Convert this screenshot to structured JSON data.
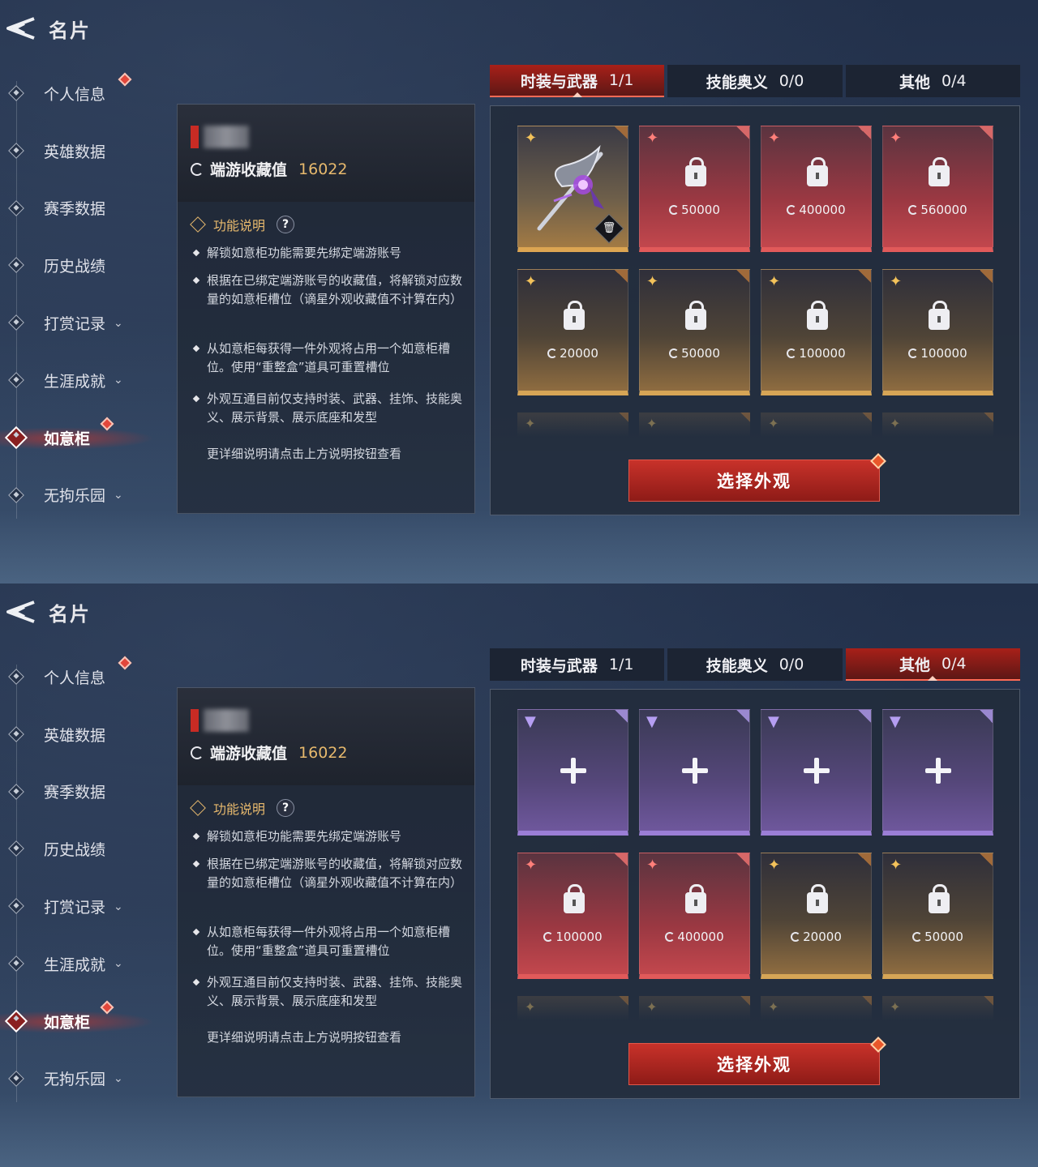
{
  "screens": [
    {
      "page_title": "名片",
      "nav": [
        {
          "label": "个人信息",
          "dot": true,
          "chevron": false
        },
        {
          "label": "英雄数据",
          "dot": false,
          "chevron": false
        },
        {
          "label": "赛季数据",
          "dot": false,
          "chevron": false
        },
        {
          "label": "历史战绩",
          "dot": false,
          "chevron": false
        },
        {
          "label": "打赏记录",
          "dot": false,
          "chevron": true
        },
        {
          "label": "生涯成就",
          "dot": false,
          "chevron": true
        },
        {
          "label": "如意柜",
          "dot": true,
          "chevron": false,
          "active": true
        },
        {
          "label": "无拘乐园",
          "dot": false,
          "chevron": true
        }
      ],
      "info": {
        "collection_label": "端游收藏值",
        "collection_value": "16022",
        "func_title": "功能说明",
        "help": "?",
        "bullets": [
          "解锁如意柜功能需要先绑定端游账号",
          "根据在已绑定端游账号的收藏值，将解锁对应数量的如意柜槽位（谪星外观收藏值不计算在内）",
          "从如意柜每获得一件外观将占用一个如意柜槽位。使用“重整盒”道具可重置槽位",
          "外观互通目前仅支持时装、武器、挂饰、技能奥义、展示背景、展示底座和发型"
        ],
        "more": "更详细说明请点击上方说明按钮查看"
      },
      "tabs": [
        {
          "label": "时装与武器",
          "count": "1/1",
          "active": true
        },
        {
          "label": "技能奥义",
          "count": "0/0",
          "active": false
        },
        {
          "label": "其他",
          "count": "0/4",
          "active": false
        }
      ],
      "slots": [
        {
          "type": "weapon",
          "color": "wep"
        },
        {
          "type": "locked",
          "color": "red",
          "cost": "50000"
        },
        {
          "type": "locked",
          "color": "red",
          "cost": "400000"
        },
        {
          "type": "locked",
          "color": "red",
          "cost": "560000"
        },
        {
          "type": "locked",
          "color": "gold",
          "cost": "20000"
        },
        {
          "type": "locked",
          "color": "gold",
          "cost": "50000"
        },
        {
          "type": "locked",
          "color": "gold",
          "cost": "100000"
        },
        {
          "type": "locked",
          "color": "gold",
          "cost": "100000"
        }
      ],
      "select_button": "选择外观"
    },
    {
      "page_title": "名片",
      "nav": [
        {
          "label": "个人信息",
          "dot": true,
          "chevron": false
        },
        {
          "label": "英雄数据",
          "dot": false,
          "chevron": false
        },
        {
          "label": "赛季数据",
          "dot": false,
          "chevron": false
        },
        {
          "label": "历史战绩",
          "dot": false,
          "chevron": false
        },
        {
          "label": "打赏记录",
          "dot": false,
          "chevron": true
        },
        {
          "label": "生涯成就",
          "dot": false,
          "chevron": true
        },
        {
          "label": "如意柜",
          "dot": true,
          "chevron": false,
          "active": true
        },
        {
          "label": "无拘乐园",
          "dot": false,
          "chevron": true
        }
      ],
      "info": {
        "collection_label": "端游收藏值",
        "collection_value": "16022",
        "func_title": "功能说明",
        "help": "?",
        "bullets": [
          "解锁如意柜功能需要先绑定端游账号",
          "根据在已绑定端游账号的收藏值，将解锁对应数量的如意柜槽位（谪星外观收藏值不计算在内）",
          "从如意柜每获得一件外观将占用一个如意柜槽位。使用“重整盒”道具可重置槽位",
          "外观互通目前仅支持时装、武器、挂饰、技能奥义、展示背景、展示底座和发型"
        ],
        "more": "更详细说明请点击上方说明按钮查看"
      },
      "tabs": [
        {
          "label": "时装与武器",
          "count": "1/1",
          "active": false
        },
        {
          "label": "技能奥义",
          "count": "0/0",
          "active": false
        },
        {
          "label": "其他",
          "count": "0/4",
          "active": true
        }
      ],
      "slots": [
        {
          "type": "empty",
          "color": "purple"
        },
        {
          "type": "empty",
          "color": "purple"
        },
        {
          "type": "empty",
          "color": "purple"
        },
        {
          "type": "empty",
          "color": "purple"
        },
        {
          "type": "locked",
          "color": "red",
          "cost": "100000"
        },
        {
          "type": "locked",
          "color": "red",
          "cost": "400000"
        },
        {
          "type": "locked",
          "color": "gold",
          "cost": "20000"
        },
        {
          "type": "locked",
          "color": "gold",
          "cost": "50000"
        }
      ],
      "select_button": "选择外观"
    }
  ]
}
